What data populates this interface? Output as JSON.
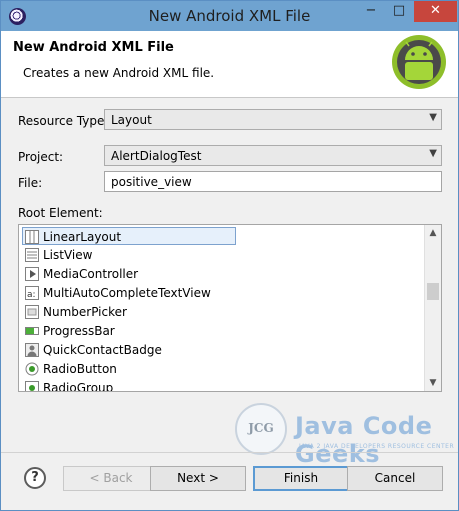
{
  "window": {
    "title": "New Android XML File",
    "minimize": "−",
    "maximize": "□",
    "close": "✕",
    "icon": "eclipse-icon"
  },
  "banner": {
    "title": "New Android XML File",
    "description": "Creates a new Android XML file.",
    "icon": "android-logo"
  },
  "form": {
    "resource_type": {
      "label": "Resource Type:",
      "value": "Layout"
    },
    "project": {
      "label": "Project:",
      "value": "AlertDialogTest"
    },
    "file": {
      "label": "File:",
      "value": "positive_view"
    },
    "root_element_label": "Root Element:"
  },
  "root_elements": [
    {
      "label": "LinearLayout",
      "icon": "linear-layout-icon",
      "selected": true
    },
    {
      "label": "ListView",
      "icon": "list-view-icon"
    },
    {
      "label": "MediaController",
      "icon": "media-controller-icon"
    },
    {
      "label": "MultiAutoCompleteTextView",
      "icon": "autocomplete-icon"
    },
    {
      "label": "NumberPicker",
      "icon": "number-picker-icon"
    },
    {
      "label": "ProgressBar",
      "icon": "progress-bar-icon"
    },
    {
      "label": "QuickContactBadge",
      "icon": "contact-badge-icon"
    },
    {
      "label": "RadioButton",
      "icon": "radio-button-icon"
    },
    {
      "label": "RadioGroup",
      "icon": "radio-group-icon"
    }
  ],
  "scroll": {
    "up": "▲",
    "down": "▼"
  },
  "watermark": {
    "logo_text": "JCG",
    "brand": "Java Code Geeks",
    "tagline": "JAVA 2 JAVA DEVELOPERS RESOURCE CENTER"
  },
  "buttons": {
    "help": "?",
    "back": "< Back",
    "next": "Next >",
    "finish": "Finish",
    "cancel": "Cancel"
  },
  "colors": {
    "titlebar": "#6fa3d0",
    "close": "#c7463d",
    "default_button_border": "#5b9ad3",
    "android_green": "#8ebe2a"
  }
}
